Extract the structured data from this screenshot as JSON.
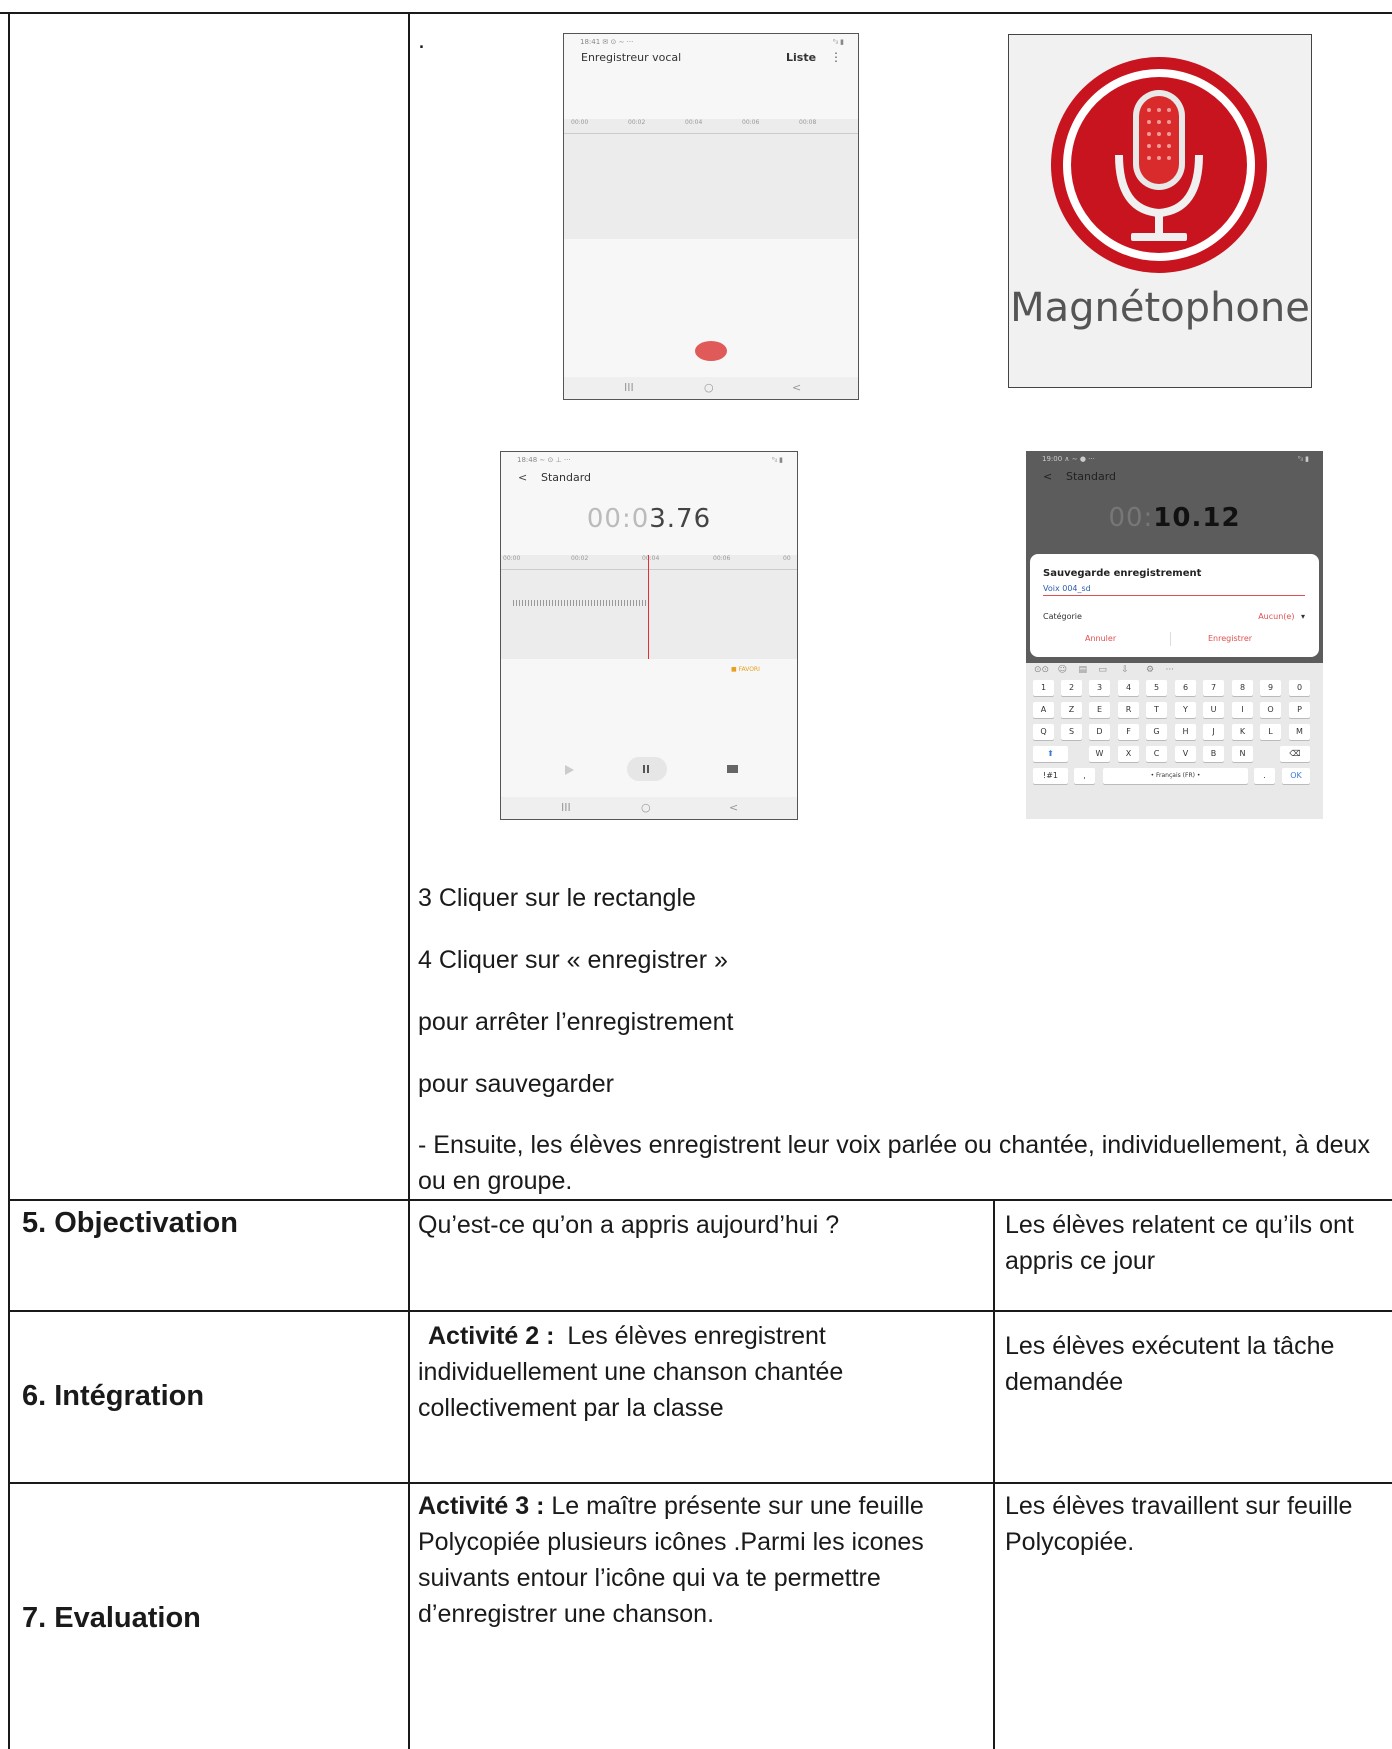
{
  "top_row": {
    "dot": ".",
    "phone1": {
      "status": "18:41 ✉ ⊙ ∼ ···",
      "status_right": "⁰ᵢₗ ▮",
      "title": "Enregistreur vocal",
      "liste": "Liste",
      "menu": "⋮",
      "ticks": [
        "00:00",
        "00:02",
        "00:04",
        "00:06",
        "00:08"
      ],
      "nav": [
        "III",
        "○",
        "<"
      ]
    },
    "magnetophone": {
      "label": "Magnétophone"
    },
    "phone2": {
      "status": "18:48 ∼ ⊙ ⊥ ···",
      "status_right": "⁰ᵢₗ ▮",
      "back": "<",
      "title": "Standard",
      "timer_light": "00:0",
      "timer_dark": "3.76",
      "ticks": [
        "00:00",
        "00:02",
        "00:04",
        "00:06",
        "00"
      ],
      "favori": "■ FAVORI",
      "nav": [
        "III",
        "○",
        "<"
      ]
    },
    "phone3": {
      "status": "19:00 ∧ ∼ ● ···",
      "status_right": "⁰ᵢₗ ▮",
      "back": "<",
      "title": "Standard",
      "timer_light": "00:",
      "timer_dark": "10.12",
      "dialog_title": "Sauvegarde enregistrement",
      "dialog_input": "Voix 004_sd",
      "category_label": "Catégorie",
      "category_value": "Aucun(e)",
      "cancel": "Annuler",
      "save": "Enregistrer",
      "keys_row1": [
        "1",
        "2",
        "3",
        "4",
        "5",
        "6",
        "7",
        "8",
        "9",
        "0"
      ],
      "keys_row2": [
        "A",
        "Z",
        "E",
        "R",
        "T",
        "Y",
        "U",
        "I",
        "O",
        "P"
      ],
      "keys_row3": [
        "Q",
        "S",
        "D",
        "F",
        "G",
        "H",
        "J",
        "K",
        "L",
        "M"
      ],
      "keys_row4": [
        "W",
        "X",
        "C",
        "V",
        "B",
        "N"
      ],
      "key_sym": "!#1",
      "key_comma": ",",
      "key_space": "• Français (FR) •",
      "key_dot": ".",
      "key_ok": "OK"
    },
    "steps": [
      "3 Cliquer sur le rectangle",
      "4 Cliquer sur « enregistrer »",
      "pour arrêter l’enregistrement",
      "pour sauvegarder",
      "- Ensuite, les élèves enregistrent leur voix parlée ou chantée, individuellement, à deux ou en groupe."
    ]
  },
  "rows": [
    {
      "heading": "5. Objectivation",
      "middle": "Qu’est-ce qu’on a appris aujourd’hui ?",
      "right": "Les élèves relatent ce qu’ils ont appris ce jour"
    },
    {
      "heading": "6. Intégration",
      "middle_bold": "Activité 2 :",
      "middle": "Les élèves enregistrent individuellement une chanson chantée collectivement par la classe",
      "right": "Les élèves exécutent la tâche demandée"
    },
    {
      "heading": "7. Evaluation",
      "middle_bold": "Activité 3 :",
      "middle": "Le maître présente sur une feuille Polycopiée plusieurs icônes .Parmi les icones suivants entour l’icône qui va te permettre d’enregistrer une chanson.",
      "right": "Les élèves travaillent sur feuille Polycopiée."
    }
  ],
  "colors": {
    "record_red": "#e05a5a",
    "mic_red": "#c8141e",
    "border": "#1a1a1a"
  }
}
